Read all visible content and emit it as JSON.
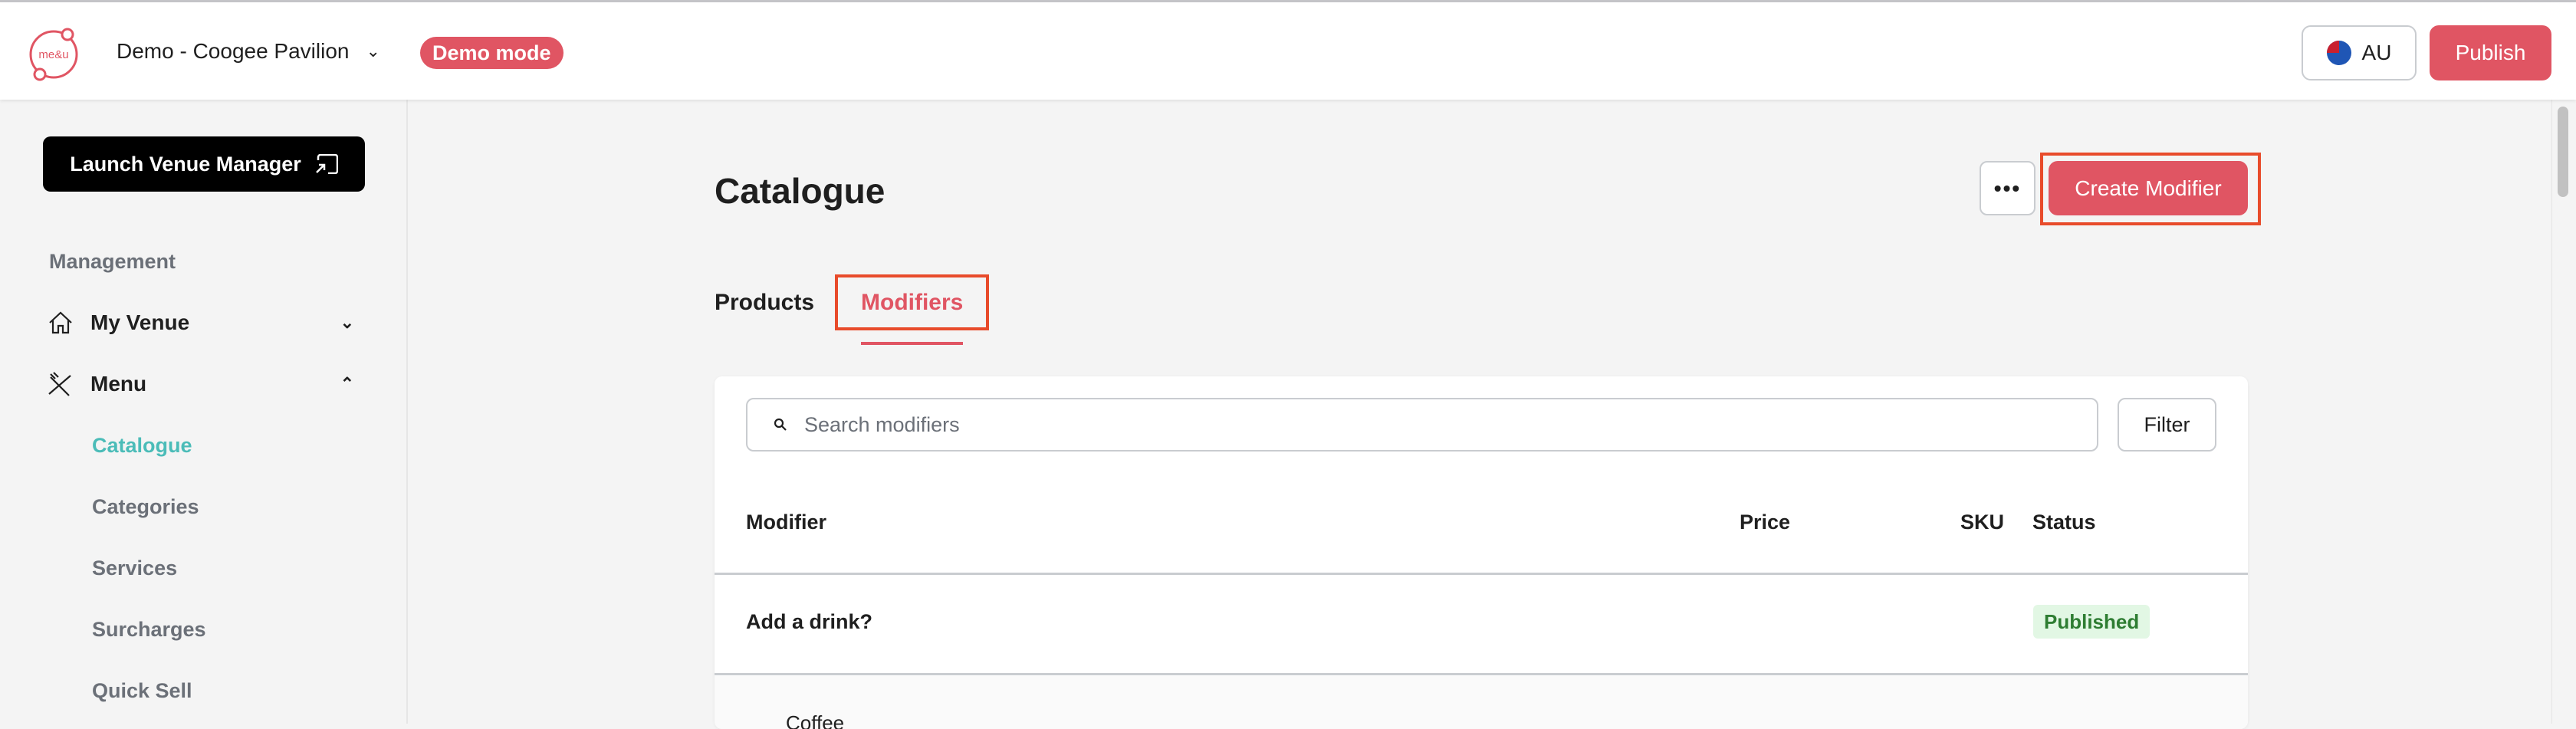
{
  "header": {
    "logo_text": "me&u",
    "venue": "Demo - Coogee Pavilion",
    "demo_badge": "Demo mode",
    "region": "AU",
    "publish": "Publish"
  },
  "sidebar": {
    "launch": "Launch Venue Manager",
    "section": "Management",
    "items": [
      {
        "label": "My Venue",
        "icon": "home-icon",
        "expanded": false
      },
      {
        "label": "Menu",
        "icon": "cutlery-icon",
        "expanded": true
      }
    ],
    "subitems": [
      {
        "label": "Catalogue",
        "active": true
      },
      {
        "label": "Categories"
      },
      {
        "label": "Services"
      },
      {
        "label": "Surcharges"
      },
      {
        "label": "Quick Sell"
      }
    ]
  },
  "main": {
    "title": "Catalogue",
    "more": "•••",
    "create": "Create Modifier",
    "tabs": [
      {
        "label": "Products"
      },
      {
        "label": "Modifiers",
        "active": true
      }
    ],
    "search_placeholder": "Search modifiers",
    "filter": "Filter",
    "columns": [
      "Modifier",
      "Price",
      "SKU",
      "Status"
    ],
    "rows": [
      {
        "name": "Add a drink?",
        "price": "",
        "sku": "",
        "status": "Published"
      },
      {
        "name": "Coffee"
      }
    ]
  },
  "colors": {
    "accent": "#e05563",
    "active_nav": "#4bbcb8",
    "published_bg": "#e2f7e4",
    "published_text": "#2e7d32",
    "highlight": "#e84b2b"
  }
}
